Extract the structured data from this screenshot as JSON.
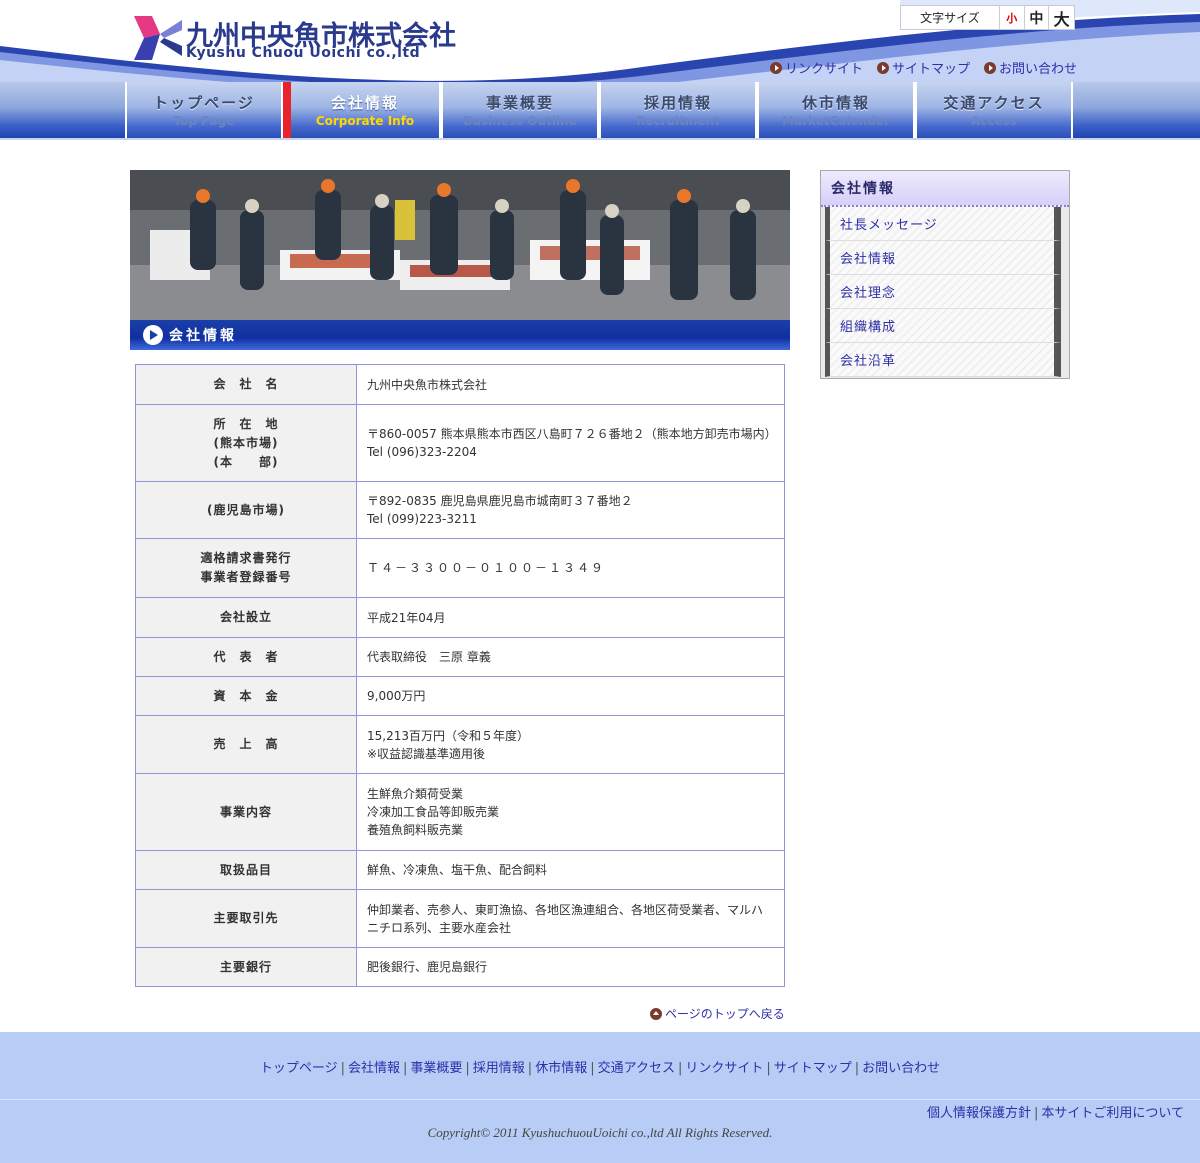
{
  "header": {
    "logo_jp": "九州中央魚市株式会社",
    "logo_en": "Kyushu Chuou Uoichi co.,ltd",
    "font_size_label": "文字サイズ",
    "font_size_small": "小",
    "font_size_mid": "中",
    "font_size_large": "大",
    "links": [
      "リンクサイト",
      "サイトマップ",
      "お問い合わせ"
    ]
  },
  "nav": [
    {
      "jp": "トップページ",
      "en": "Top Page"
    },
    {
      "jp": "会社情報",
      "en": "Corporate Info"
    },
    {
      "jp": "事業概要",
      "en": "Business Outline"
    },
    {
      "jp": "採用情報",
      "en": "Recruitment"
    },
    {
      "jp": "休市情報",
      "en": "MarketCalender"
    },
    {
      "jp": "交通アクセス",
      "en": "Access"
    }
  ],
  "nav_active_index": 1,
  "banner": {
    "title": "会社情報"
  },
  "table": {
    "rows": [
      {
        "label": "会　社　名",
        "lines": [
          "九州中央魚市株式会社"
        ]
      },
      {
        "label_lines": [
          "所　在　地",
          "(熊本市場)",
          "(本　　部)"
        ],
        "lines": [
          "〒860-0057 熊本県熊本市西区八島町７２６番地２（熊本地方卸売市場内）",
          "Tel (096)323-2204"
        ]
      },
      {
        "label": "(鹿児島市場)",
        "lines": [
          "〒892-0835 鹿児島県鹿児島市城南町３７番地２",
          "Tel (099)223-3211"
        ]
      },
      {
        "label_lines": [
          "適格請求書発行",
          "事業者登録番号"
        ],
        "lines": [
          "Ｔ４－３３００－０１００－１３４９"
        ]
      },
      {
        "label": "会社設立",
        "lines": [
          "平成21年04月"
        ]
      },
      {
        "label": "代　表　者",
        "lines": [
          "代表取締役　三原 章義"
        ]
      },
      {
        "label": "資　本　金",
        "lines": [
          "9,000万円"
        ]
      },
      {
        "label": "売　上　高",
        "lines": [
          "15,213百万円（令和５年度）",
          "※収益認識基準適用後"
        ]
      },
      {
        "label": "事業内容",
        "lines": [
          "生鮮魚介類荷受業",
          "冷凍加工食品等卸販売業",
          "養殖魚飼料販売業"
        ]
      },
      {
        "label": "取扱品目",
        "lines": [
          "鮮魚、冷凍魚、塩干魚、配合飼料"
        ]
      },
      {
        "label": "主要取引先",
        "lines": [
          "仲卸業者、売参人、東町漁協、各地区漁連組合、各地区荷受業者、マルハニチロ系列、主要水産会社"
        ]
      },
      {
        "label": "主要銀行",
        "lines": [
          "肥後銀行、鹿児島銀行"
        ]
      }
    ]
  },
  "back_to_top": "ページのトップへ戻る",
  "sidebar": {
    "title": "会社情報",
    "items": [
      "社長メッセージ",
      "会社情報",
      "会社理念",
      "組織構成",
      "会社沿革"
    ]
  },
  "footer": {
    "nav": [
      "トップページ",
      "会社情報",
      "事業概要",
      "採用情報",
      "休市情報",
      "交通アクセス",
      "リンクサイト",
      "サイトマップ",
      "お問い合わせ"
    ],
    "policy_links": [
      "個人情報保護方針",
      "本サイトご利用について"
    ],
    "copyright": "Copyright© 2011 KyushuchuouUoichi co.,ltd All Rights Reserved."
  },
  "colors": {
    "brand_navy": "#2a3a8c",
    "link_blue": "#2f2fa8",
    "active_red": "#e8232a",
    "active_en_yellow": "#ffd800",
    "table_border": "#8f96d6",
    "footer_bg": "#b7cdf6"
  }
}
